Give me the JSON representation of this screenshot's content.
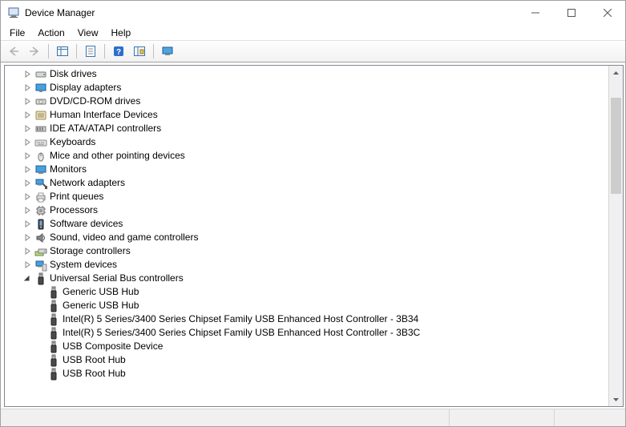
{
  "window": {
    "title": "Device Manager"
  },
  "menu": {
    "file": "File",
    "action": "Action",
    "view": "View",
    "help": "Help"
  },
  "tree": {
    "categories": [
      {
        "icon": "disk",
        "label": "Disk drives",
        "expanded": false
      },
      {
        "icon": "display",
        "label": "Display adapters",
        "expanded": false
      },
      {
        "icon": "dvd",
        "label": "DVD/CD-ROM drives",
        "expanded": false
      },
      {
        "icon": "hid",
        "label": "Human Interface Devices",
        "expanded": false
      },
      {
        "icon": "ide",
        "label": "IDE ATA/ATAPI controllers",
        "expanded": false
      },
      {
        "icon": "keyboard",
        "label": "Keyboards",
        "expanded": false
      },
      {
        "icon": "mouse",
        "label": "Mice and other pointing devices",
        "expanded": false
      },
      {
        "icon": "monitor",
        "label": "Monitors",
        "expanded": false
      },
      {
        "icon": "network",
        "label": "Network adapters",
        "expanded": false
      },
      {
        "icon": "printer",
        "label": "Print queues",
        "expanded": false
      },
      {
        "icon": "cpu",
        "label": "Processors",
        "expanded": false
      },
      {
        "icon": "software",
        "label": "Software devices",
        "expanded": false
      },
      {
        "icon": "sound",
        "label": "Sound, video and game controllers",
        "expanded": false
      },
      {
        "icon": "storage",
        "label": "Storage controllers",
        "expanded": false
      },
      {
        "icon": "system",
        "label": "System devices",
        "expanded": false
      },
      {
        "icon": "usb",
        "label": "Universal Serial Bus controllers",
        "expanded": true,
        "children": [
          {
            "icon": "usb",
            "label": "Generic USB Hub"
          },
          {
            "icon": "usb",
            "label": "Generic USB Hub"
          },
          {
            "icon": "usb",
            "label": "Intel(R) 5 Series/3400 Series Chipset Family USB Enhanced Host Controller - 3B34"
          },
          {
            "icon": "usb",
            "label": "Intel(R) 5 Series/3400 Series Chipset Family USB Enhanced Host Controller - 3B3C"
          },
          {
            "icon": "usb",
            "label": "USB Composite Device"
          },
          {
            "icon": "usb",
            "label": "USB Root Hub"
          },
          {
            "icon": "usb",
            "label": "USB Root Hub"
          }
        ]
      }
    ]
  }
}
